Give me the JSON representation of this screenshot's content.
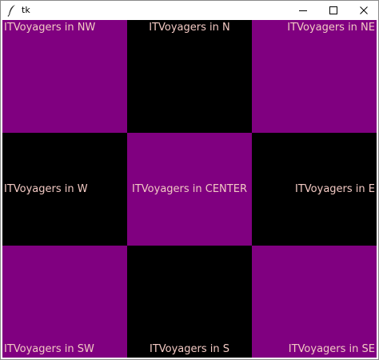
{
  "window": {
    "title": "tk",
    "controls": {
      "minimize_icon": "minimize-icon",
      "maximize_icon": "maximize-icon",
      "close_icon": "close-icon"
    }
  },
  "colors": {
    "purple": "#800080",
    "black": "#000000",
    "label_text": "#f2c9c3"
  },
  "cells": {
    "nw": "ITVoyagers in NW",
    "n": "ITVoyagers in N",
    "ne": "ITVoyagers in NE",
    "w": "ITVoyagers in W",
    "center": "ITVoyagers in CENTER",
    "e": "ITVoyagers in E",
    "sw": "ITVoyagers in SW",
    "s": "ITVoyagers in S",
    "se": "ITVoyagers in SE"
  }
}
